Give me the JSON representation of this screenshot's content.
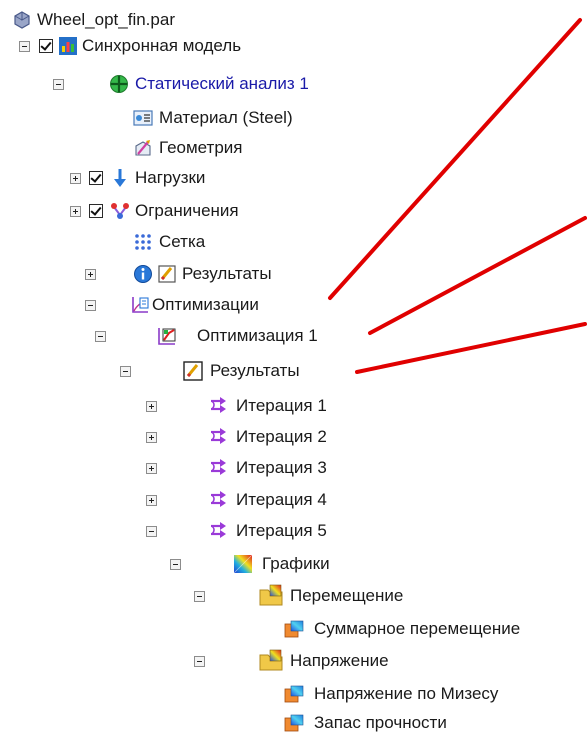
{
  "tree": {
    "file": "Wheel_opt_fin.par",
    "sync_model": "Синхронная модель",
    "static_analysis": "Статический анализ 1",
    "material": "Материал (Steel)",
    "geometry": "Геометрия",
    "loads": "Нагрузки",
    "constraints": "Ограничения",
    "mesh": "Сетка",
    "results": "Результаты",
    "optimizations": "Оптимизации",
    "optimization1": "Оптимизация 1",
    "opt_results": "Результаты",
    "iterations": [
      "Итерация 1",
      "Итерация 2",
      "Итерация 3",
      "Итерация 4",
      "Итерация 5"
    ],
    "plots": "Графики",
    "displacement": "Перемещение",
    "total_displacement": "Суммарное перемещение",
    "stress": "Напряжение",
    "von_mises": "Напряжение по Мизесу",
    "safety_factor": "Запас прочности"
  },
  "colors": {
    "arrow": "#e00000",
    "link_text": "#1a1aa8"
  },
  "icons": [
    "part-file-icon",
    "sync-model-icon",
    "static-study-icon",
    "material-icon",
    "geometry-icon",
    "loads-icon",
    "constraints-icon",
    "mesh-icon",
    "info-icon",
    "results-icon",
    "optimizations-icon",
    "optimization-icon",
    "iteration-icon",
    "plots-icon",
    "plot-folder-icon",
    "result-plot-icon"
  ]
}
